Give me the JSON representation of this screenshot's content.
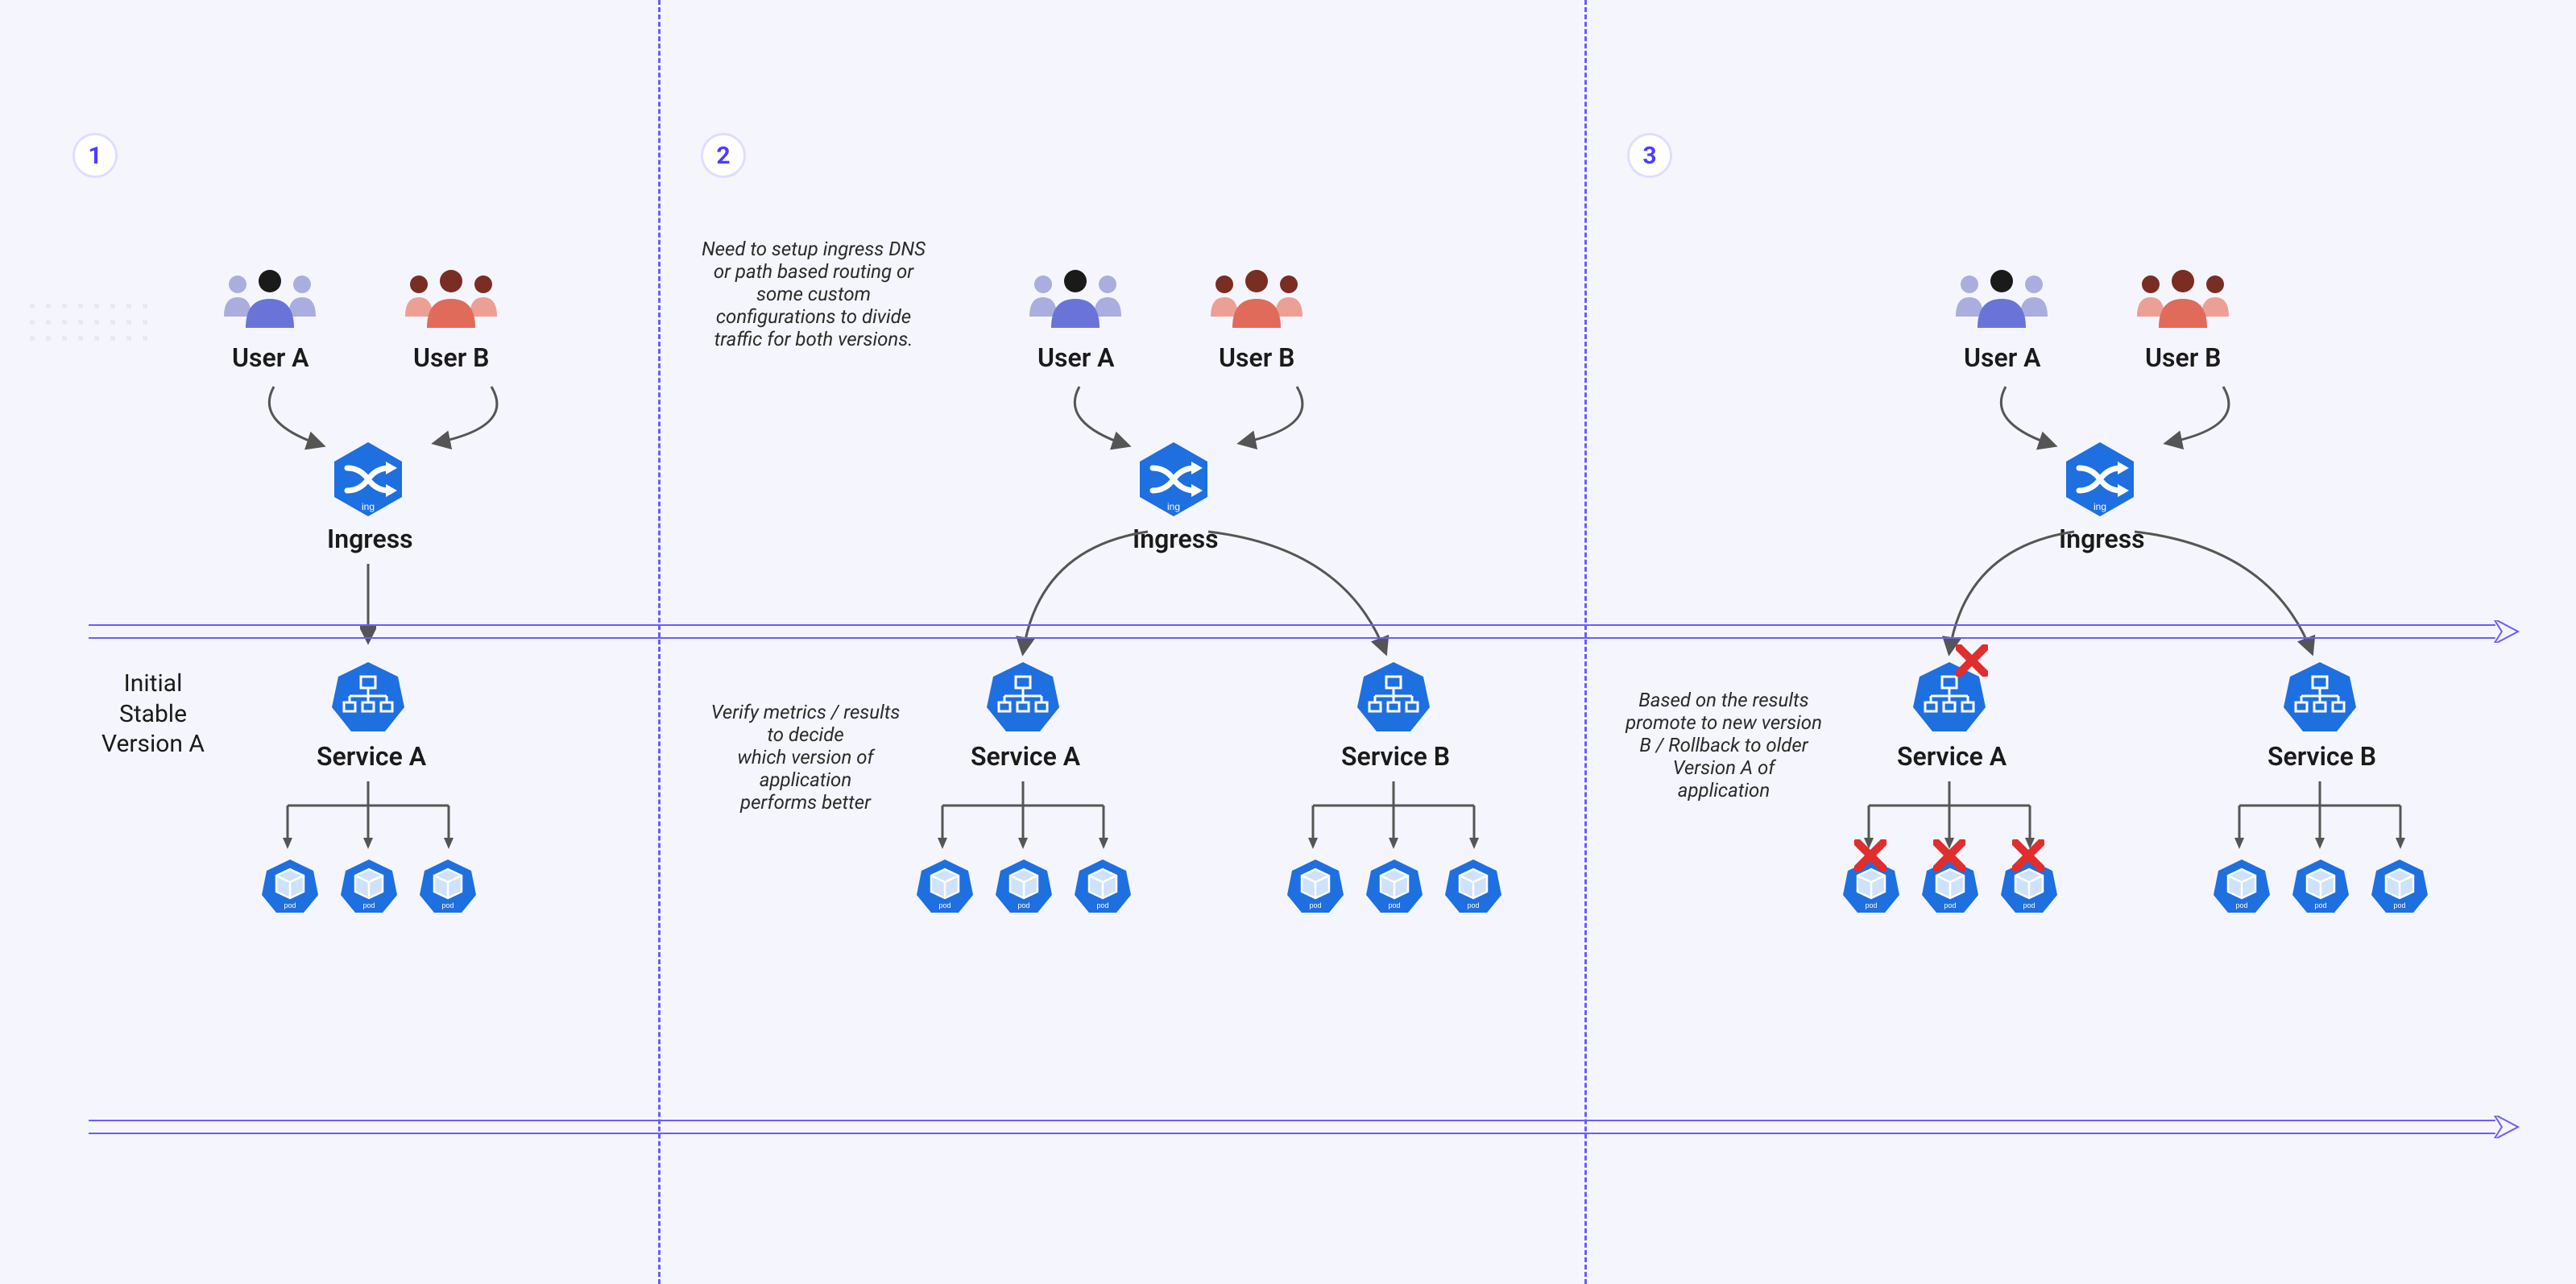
{
  "steps": {
    "one": "1",
    "two": "2",
    "three": "3"
  },
  "labels": {
    "userA": "User A",
    "userB": "User B",
    "ingress": "Ingress",
    "serviceA": "Service A",
    "serviceB": "Service B"
  },
  "notes": {
    "panel1_side": "Initial\nStable\nVersion A",
    "panel2_top": "Need to setup ingress DNS\nor path based routing or\nsome custom\nconfigurations to divide\ntraffic for both versions.",
    "panel2_side": "Verify metrics / results\nto decide\nwhich version of\napplication\nperforms better",
    "panel3_side": "Based on the results\npromote to new version\nB / Rollback to older\nVersion A of\napplication"
  },
  "colors": {
    "accent": "#4b3eff",
    "k8sBlue": "#1e6fe0",
    "userBlue": "#6a74d8",
    "userRed": "#e06b5a",
    "xRed": "#e02d2d",
    "arrowGrey": "#555"
  },
  "chart_data": {
    "type": "table",
    "description": "Three-stage A/B (canary-style) deployment flow using Kubernetes Ingress and two Services, each backed by 3 pods.",
    "stages": [
      {
        "stage": 1,
        "badge": "1",
        "services": [
          "Service A"
        ],
        "pods_per_service": 3,
        "caption": "Initial Stable Version A",
        "routing": "Ingress -> Service A only"
      },
      {
        "stage": 2,
        "badge": "2",
        "services": [
          "Service A",
          "Service B"
        ],
        "pods_per_service": 3,
        "caption": "Need to setup ingress DNS or path based routing or some custom configurations to divide traffic for both versions.",
        "side_caption": "Verify metrics / results to decide which version of application performs better",
        "routing": "Ingress splits traffic between Service A and Service B"
      },
      {
        "stage": 3,
        "badge": "3",
        "services": [
          "Service A",
          "Service B"
        ],
        "pods_per_service": 3,
        "service_a_terminated": true,
        "caption": "Based on the results promote to new version B / Rollback to older Version A of application",
        "routing": "Service A (and its pods) removed; Service B promoted"
      }
    ],
    "actors": [
      "User A",
      "User B"
    ],
    "central_node": "Ingress"
  }
}
